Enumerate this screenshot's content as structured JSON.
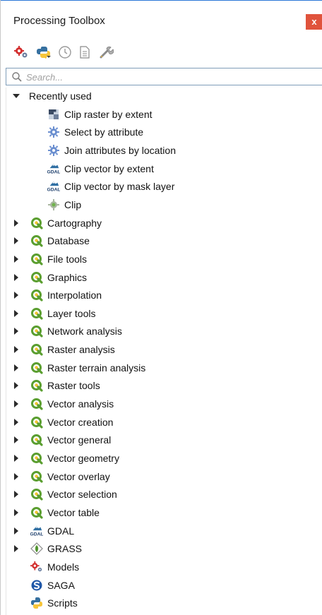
{
  "panel": {
    "title": "Processing Toolbox",
    "close_glyph": "x"
  },
  "toolbar": {
    "buttons": [
      {
        "icon": "models-gear-icon"
      },
      {
        "icon": "python-scripts-icon"
      },
      {
        "icon": "history-clock-icon"
      },
      {
        "icon": "results-viewer-icon"
      },
      {
        "icon": "options-wrench-icon"
      }
    ]
  },
  "search": {
    "placeholder": "Search..."
  },
  "tree": {
    "recently_used": {
      "label": "Recently used",
      "expanded": true,
      "items": [
        {
          "label": "Clip raster by extent",
          "icon": "raster-clip-icon"
        },
        {
          "label": "Select by attribute",
          "icon": "gear-icon"
        },
        {
          "label": "Join attributes by location",
          "icon": "gear-icon"
        },
        {
          "label": "Clip vector by extent",
          "icon": "gdal-icon"
        },
        {
          "label": "Clip vector by mask layer",
          "icon": "gdal-icon"
        },
        {
          "label": "Clip",
          "icon": "clip-gear-icon"
        }
      ]
    },
    "groups": [
      {
        "label": "Cartography",
        "icon": "qgis-icon"
      },
      {
        "label": "Database",
        "icon": "qgis-icon"
      },
      {
        "label": "File tools",
        "icon": "qgis-icon"
      },
      {
        "label": "Graphics",
        "icon": "qgis-icon"
      },
      {
        "label": "Interpolation",
        "icon": "qgis-icon"
      },
      {
        "label": "Layer tools",
        "icon": "qgis-icon"
      },
      {
        "label": "Network analysis",
        "icon": "qgis-icon"
      },
      {
        "label": "Raster analysis",
        "icon": "qgis-icon"
      },
      {
        "label": "Raster terrain analysis",
        "icon": "qgis-icon"
      },
      {
        "label": "Raster tools",
        "icon": "qgis-icon"
      },
      {
        "label": "Vector analysis",
        "icon": "qgis-icon"
      },
      {
        "label": "Vector creation",
        "icon": "qgis-icon"
      },
      {
        "label": "Vector general",
        "icon": "qgis-icon"
      },
      {
        "label": "Vector geometry",
        "icon": "qgis-icon"
      },
      {
        "label": "Vector overlay",
        "icon": "qgis-icon"
      },
      {
        "label": "Vector selection",
        "icon": "qgis-icon"
      },
      {
        "label": "Vector table",
        "icon": "qgis-icon"
      }
    ],
    "providers": [
      {
        "label": "GDAL",
        "icon": "gdal-icon",
        "expandable": true
      },
      {
        "label": "GRASS",
        "icon": "grass-icon",
        "expandable": true
      },
      {
        "label": "Models",
        "icon": "models-gear-icon",
        "expandable": false
      },
      {
        "label": "SAGA",
        "icon": "saga-icon",
        "expandable": false
      },
      {
        "label": "Scripts",
        "icon": "python-icon",
        "expandable": false
      }
    ]
  },
  "colors": {
    "accent": "#2b78d8",
    "close": "#e0533c",
    "qgis_green": "#5a9e2f",
    "gear_blue": "#6b8fd0",
    "models_red": "#d32f2f"
  }
}
